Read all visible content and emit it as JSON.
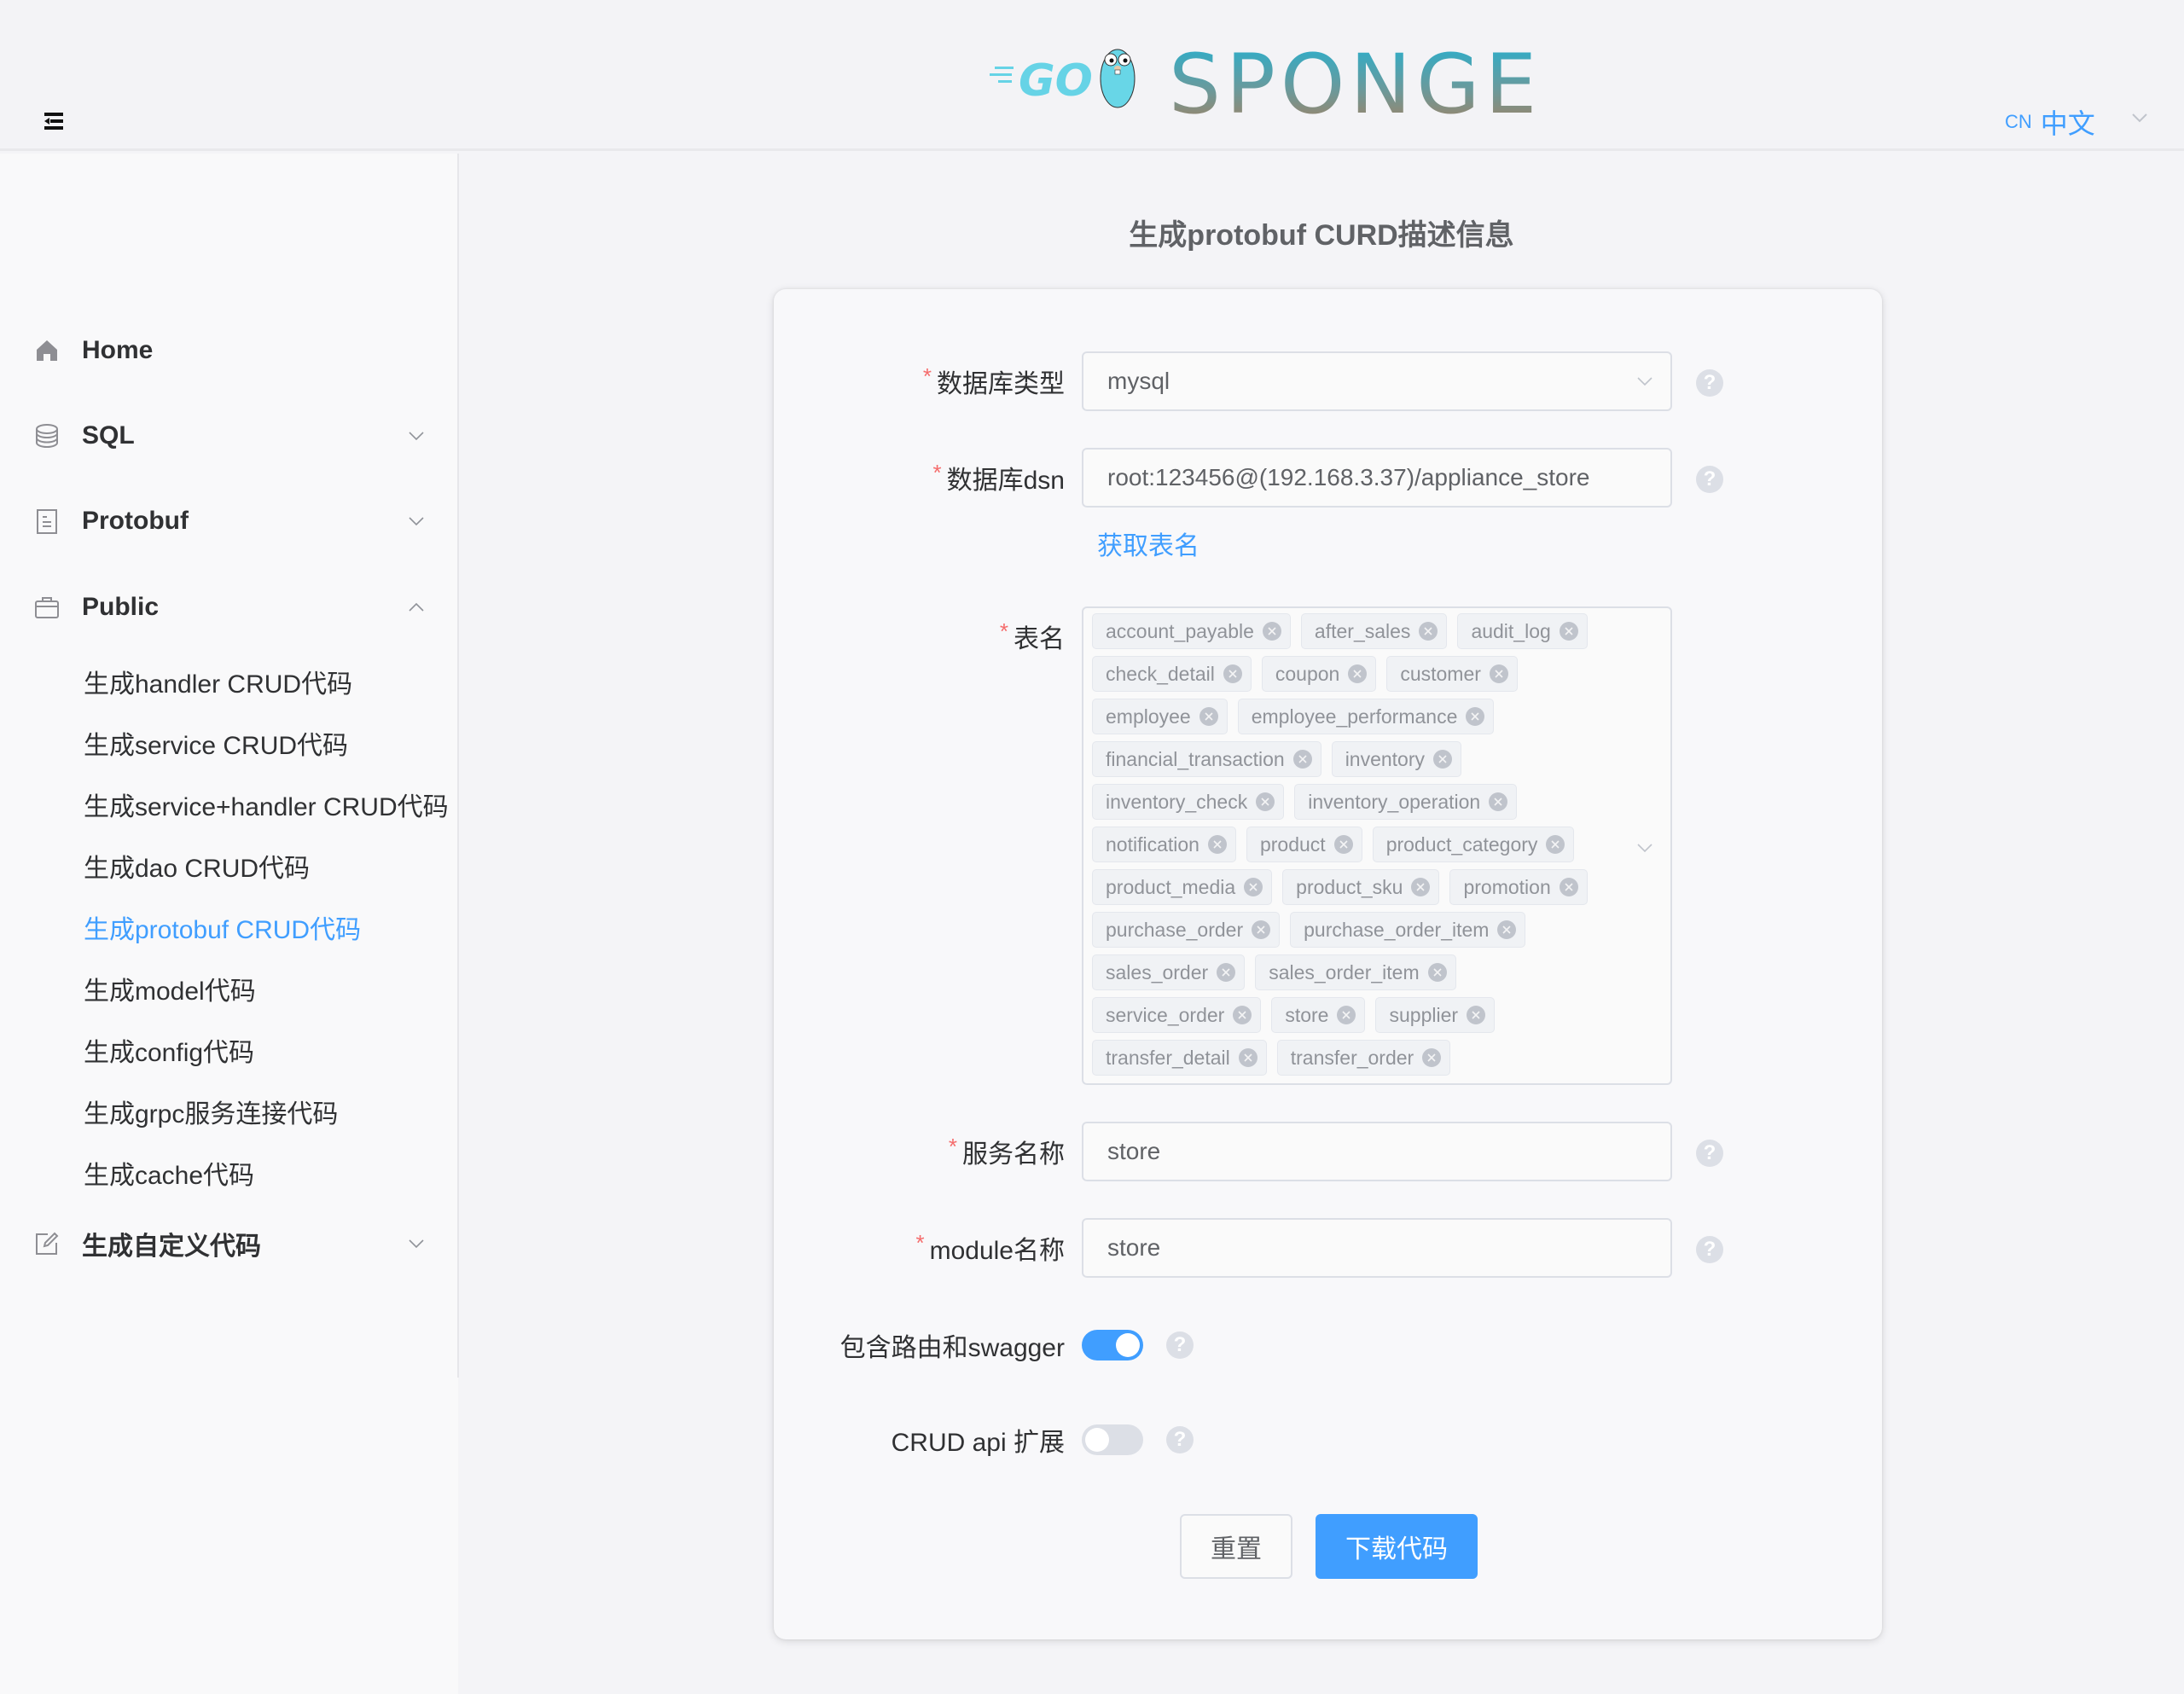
{
  "header": {
    "logo": {
      "text_go": "GO",
      "text_brand": "SPONGE"
    },
    "language": {
      "code": "CN",
      "label": "中文"
    },
    "icons": {
      "fold": "menu-fold-icon",
      "lang_dropdown": "chevron-down-icon"
    }
  },
  "sidebar": {
    "items": [
      {
        "label": "Home",
        "icon": "home-icon",
        "expandable": false
      },
      {
        "label": "SQL",
        "icon": "database-icon",
        "expandable": true,
        "expanded": false
      },
      {
        "label": "Protobuf",
        "icon": "document-icon",
        "expandable": true,
        "expanded": false
      },
      {
        "label": "Public",
        "icon": "briefcase-icon",
        "expandable": true,
        "expanded": true
      },
      {
        "label": "生成自定义代码",
        "icon": "edit-icon",
        "expandable": true,
        "expanded": false
      }
    ],
    "public_submenu": [
      {
        "label": "生成handler CRUD代码",
        "active": false
      },
      {
        "label": "生成service CRUD代码",
        "active": false
      },
      {
        "label": "生成service+handler CRUD代码",
        "active": false
      },
      {
        "label": "生成dao CRUD代码",
        "active": false
      },
      {
        "label": "生成protobuf CRUD代码",
        "active": true
      },
      {
        "label": "生成model代码",
        "active": false
      },
      {
        "label": "生成config代码",
        "active": false
      },
      {
        "label": "生成grpc服务连接代码",
        "active": false
      },
      {
        "label": "生成cache代码",
        "active": false
      }
    ]
  },
  "main": {
    "title": "生成protobuf CURD描述信息",
    "form": {
      "db_type": {
        "label": "数据库类型",
        "required": true,
        "value": "mysql"
      },
      "db_dsn": {
        "label": "数据库dsn",
        "required": true,
        "value": "root:123456@(192.168.3.37)/appliance_store"
      },
      "fetch_tables_link": "获取表名",
      "tables": {
        "label": "表名",
        "required": true,
        "selected": [
          "account_payable",
          "after_sales",
          "audit_log",
          "check_detail",
          "coupon",
          "customer",
          "employee",
          "employee_performance",
          "financial_transaction",
          "inventory",
          "inventory_check",
          "inventory_operation",
          "notification",
          "product",
          "product_category",
          "product_media",
          "product_sku",
          "promotion",
          "purchase_order",
          "purchase_order_item",
          "sales_order",
          "sales_order_item",
          "service_order",
          "store",
          "supplier",
          "transfer_detail",
          "transfer_order"
        ]
      },
      "service_name": {
        "label": "服务名称",
        "required": true,
        "value": "store"
      },
      "module_name": {
        "label": "module名称",
        "required": true,
        "value": "store"
      },
      "include_router_swagger": {
        "label": "包含路由和swagger",
        "required": false,
        "checked": true
      },
      "crud_api_extend": {
        "label": "CRUD api 扩展",
        "required": false,
        "checked": false
      },
      "help_glyph": "?",
      "required_mark": "*"
    },
    "buttons": {
      "reset": "重置",
      "download": "下载代码"
    }
  },
  "colors": {
    "primary": "#409eff",
    "required": "#f56c6c",
    "text": "#303133",
    "muted": "#606266"
  }
}
